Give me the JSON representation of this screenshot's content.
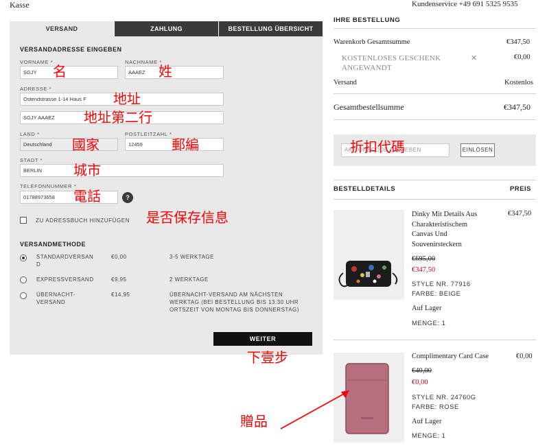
{
  "header": {
    "title": "Kasse",
    "service": "Kundenservice +49 691 5325 9535"
  },
  "tabs": [
    {
      "label": "VERSAND"
    },
    {
      "label": "ZAHLUNG"
    },
    {
      "label": "BESTELLUNG ÜBERSICHT"
    }
  ],
  "address": {
    "heading": "VERSANDADRESSE EINGEBEN",
    "firstname_label": "VORNAME *",
    "firstname_value": "SGJY",
    "lastname_label": "NACHNAME *",
    "lastname_value": "AAAEZ",
    "address_label": "ADRESSE *",
    "address1_value": "Ostendstrasse 1-14 Haus F",
    "address2_value": "SGJY AAAEZ",
    "country_label": "LAND *",
    "country_value": "Deutschland",
    "zip_label": "POSTLEITZAHL *",
    "zip_value": "12459",
    "city_label": "STADT *",
    "city_value": "BERLIN",
    "phone_label": "TELEFONNUMMER *",
    "phone_value": "01788973658",
    "help_symbol": "?",
    "addressbook_label": "ZU ADRESSBUCH HINZUFÜGEN"
  },
  "shipping": {
    "heading": "VERSANDMETHODE",
    "methods": [
      {
        "name": "STANDARDVERSAN\nD",
        "price": "€0,00",
        "time": "3-5 WERKTAGE",
        "selected": true
      },
      {
        "name": "EXPRESSVERSAND",
        "price": "€9,95",
        "time": "2 WERKTAGE",
        "selected": false
      },
      {
        "name": "ÜBERNACHT-\nVERSAND",
        "price": "€14,95",
        "time": "ÜBERNACHT-VERSAND AM NÄCHSTEN\nWERKTAG (BEI BESTELLUNG BIS 13:30 UHR\nORTSZEIT VON MONTAG BIS DONNERSTAG)",
        "selected": false
      }
    ],
    "next_label": "WEITER"
  },
  "annotations": {
    "firstname": "名",
    "lastname": "姓",
    "address": "地址",
    "address2": "地址第二行",
    "country": "國家",
    "zip": "郵編",
    "city": "城市",
    "phone": "電話",
    "save": "是否保存信息",
    "next": "下壹步",
    "discount": "折扣代碼",
    "gift": "贈品"
  },
  "order": {
    "heading": "IHRE BESTELLUNG",
    "subtotal_label": "Warenkorb Gesamtsumme",
    "subtotal_value": "€347,50",
    "gift_text": "KOSTENLOSES GESCHENK\nANGEWANDT",
    "gift_remove": "✕",
    "gift_value": "€0,00",
    "shipping_label": "Versand",
    "shipping_value": "Kostenlos",
    "total_label": "Gesamtbestellsumme",
    "total_value": "€347,50",
    "discount_placeholder": "AKTIONSCODE EINGEBEN",
    "discount_button": "EINLÖSEN",
    "details_heading": "BESTELLDETAILS",
    "price_heading": "PREIS",
    "accent_red": "#d0021b",
    "items": [
      {
        "name": "Dinky Mit Details Aus\nCharakteristischem\nCanvas Und\nSouvenirsteckern",
        "price": "€347,50",
        "old_price": "€695,00",
        "new_price": "€347,50",
        "style": "STYLE NR. 77916",
        "color": "FARBE: BEIGE",
        "stock": "Auf Lager",
        "qty": "MENGE: 1"
      },
      {
        "name": "Complimentary Card Case",
        "price": "€0,00",
        "old_price": "€40,00",
        "new_price": "€0,00",
        "style": "STYLE NR. 24760G",
        "color": "FARBE: ROSE",
        "stock": "Auf Lager",
        "qty": "MENGE: 1"
      }
    ]
  }
}
